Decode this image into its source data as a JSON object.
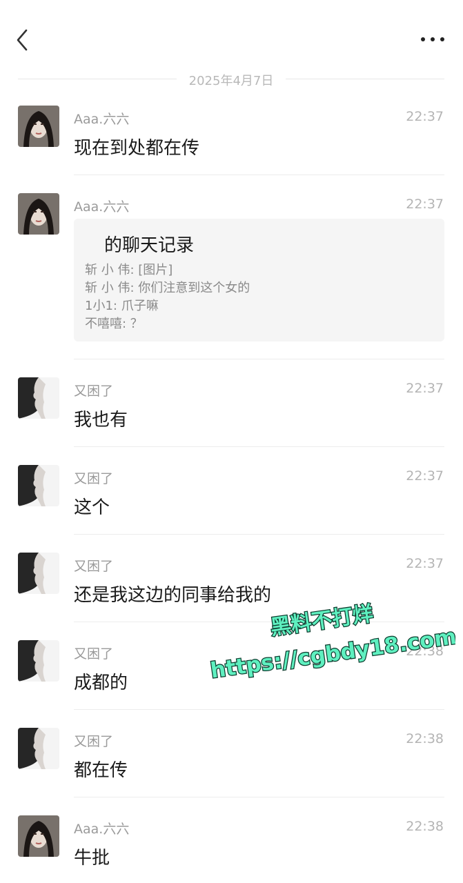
{
  "header": {
    "back_icon": "chevron-left-icon",
    "more_icon": "ellipsis-icon"
  },
  "date_divider": "2025年4月7日",
  "messages": [
    {
      "sender": "Aaa.六六",
      "time": "22:37",
      "text": "现在到处都在传",
      "avatar": "female-portrait"
    },
    {
      "sender": "Aaa.六六",
      "time": "22:37",
      "avatar": "female-portrait",
      "card": {
        "title": "的聊天记录",
        "lines": [
          "斩 小 伟: [图片]",
          "斩 小 伟: 你们注意到这个女的",
          "1小1: 爪子嘛",
          "不嘻嘻: ？"
        ]
      }
    },
    {
      "sender": "又困了",
      "time": "22:37",
      "text": "我也有",
      "avatar": "profile-silhouette"
    },
    {
      "sender": "又困了",
      "time": "22:37",
      "text": "这个",
      "avatar": "profile-silhouette"
    },
    {
      "sender": "又困了",
      "time": "22:37",
      "text": "还是我这边的同事给我的",
      "avatar": "profile-silhouette"
    },
    {
      "sender": "又困了",
      "time": "22:38",
      "text": "成都的",
      "avatar": "profile-silhouette"
    },
    {
      "sender": "又困了",
      "time": "22:38",
      "text": "都在传",
      "avatar": "profile-silhouette"
    },
    {
      "sender": "Aaa.六六",
      "time": "22:38",
      "text": "牛批",
      "avatar": "female-portrait"
    }
  ],
  "watermark": {
    "line1": "黑料不打烊",
    "line2": "https://cgbdy18.com",
    "color": "#5ff0c0"
  }
}
